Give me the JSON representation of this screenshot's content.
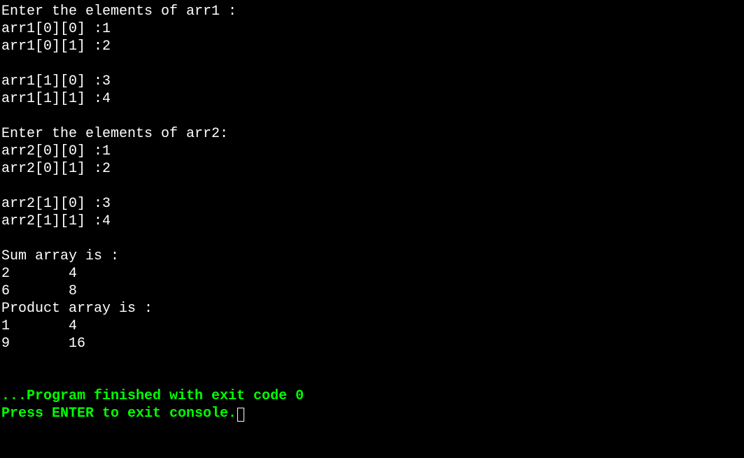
{
  "lines": {
    "prompt_arr1": "Enter the elements of arr1 :",
    "arr1_00": "arr1[0][0] :1",
    "arr1_01": "arr1[0][1] :2",
    "blank1": "",
    "arr1_10": "arr1[1][0] :3",
    "arr1_11": "arr1[1][1] :4",
    "blank2": "",
    "prompt_arr2": "Enter the elements of arr2:",
    "arr2_00": "arr2[0][0] :1",
    "arr2_01": "arr2[0][1] :2",
    "blank3": "",
    "arr2_10": "arr2[1][0] :3",
    "arr2_11": "arr2[1][1] :4",
    "blank4": "",
    "sum_header": "Sum array is :",
    "sum_row1": "2       4",
    "sum_row2": "6       8",
    "product_header": "Product array is :",
    "product_row1": "1       4",
    "product_row2": "9       16",
    "blank5": "",
    "blank6": ""
  },
  "footer": {
    "finished": "...Program finished with exit code 0",
    "press_enter": "Press ENTER to exit console."
  }
}
